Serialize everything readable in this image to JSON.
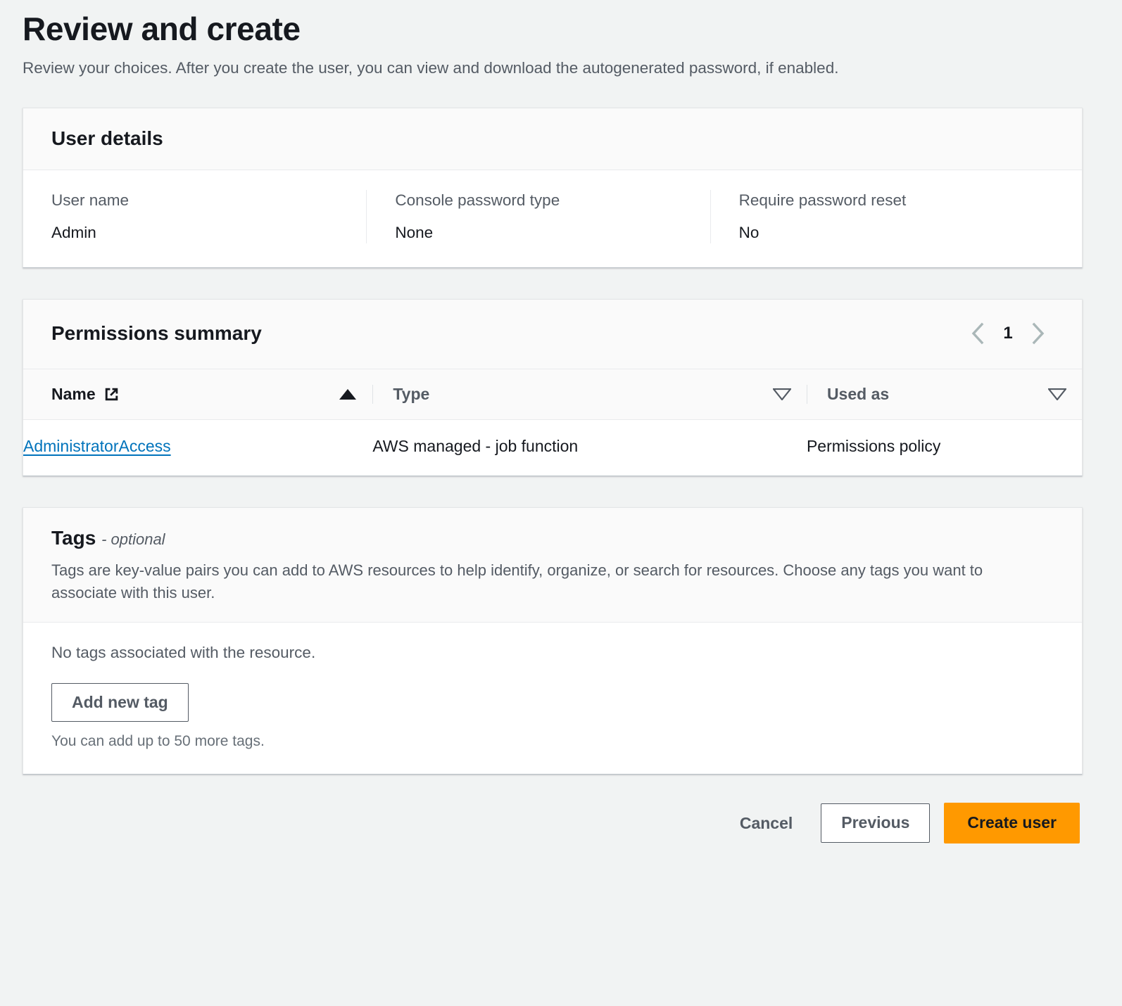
{
  "header": {
    "title": "Review and create",
    "subtitle": "Review your choices. After you create the user, you can view and download the autogenerated password, if enabled."
  },
  "user_details": {
    "title": "User details",
    "fields": [
      {
        "label": "User name",
        "value": "Admin"
      },
      {
        "label": "Console password type",
        "value": "None"
      },
      {
        "label": "Require password reset",
        "value": "No"
      }
    ]
  },
  "permissions": {
    "title": "Permissions summary",
    "pagination": {
      "prev_icon": "chevron-left-icon",
      "page": "1",
      "next_icon": "chevron-right-icon"
    },
    "columns": [
      {
        "label": "Name",
        "icon": "external-link-icon",
        "sort": "ascending",
        "sort_icon": "triangle-up-icon",
        "active": true
      },
      {
        "label": "Type",
        "icon": "",
        "sort": "none",
        "sort_icon": "triangle-down-icon",
        "active": false
      },
      {
        "label": "Used as",
        "icon": "",
        "sort": "none",
        "sort_icon": "triangle-down-icon",
        "active": false
      }
    ],
    "rows": [
      {
        "name": "AdministratorAccess",
        "type": "AWS managed - job function",
        "used_as": "Permissions policy"
      }
    ]
  },
  "tags": {
    "title": "Tags",
    "optional_label": "- optional",
    "description": "Tags are key-value pairs you can add to AWS resources to help identify, organize, or search for resources. Choose any tags you want to associate with this user.",
    "empty_text": "No tags associated with the resource.",
    "add_button": "Add new tag",
    "hint": "You can add up to 50 more tags."
  },
  "footer": {
    "cancel": "Cancel",
    "previous": "Previous",
    "create": "Create user"
  },
  "colors": {
    "page_background": "#f1f3f3",
    "card_background": "#ffffff",
    "card_header_background": "#fafafa",
    "primary_button": "#ff9900",
    "link": "#0073bb",
    "secondary_text": "#545b64",
    "text": "#16191f"
  }
}
